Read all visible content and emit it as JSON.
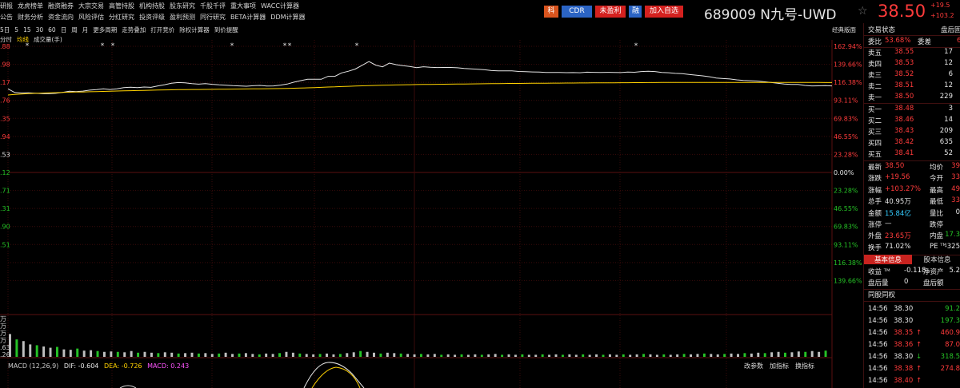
{
  "menu": {
    "row1": [
      "研报",
      "龙虎榜单",
      "融资融券",
      "大宗交易",
      "高管持股",
      "机构持股",
      "股东研究",
      "千股千评",
      "重大事项",
      "WACC计算器"
    ],
    "row2": [
      "公告",
      "财务分析",
      "资金流向",
      "风险评估",
      "分红研究",
      "投资评级",
      "盈利预测",
      "同行研究",
      "BETA计算器",
      "DDM计算器"
    ]
  },
  "toolbar": {
    "items": [
      "5日",
      "5",
      "15",
      "30",
      "60",
      "日",
      "周",
      "月",
      "更多周期",
      "走势叠加",
      "打开竞价",
      "除权计算器",
      "到价提醒"
    ],
    "right_label": "经典版面"
  },
  "subtabs": {
    "items": [
      "分时",
      "均线",
      "成交量(手)"
    ],
    "active": 1
  },
  "header": {
    "tags": [
      {
        "label": "科",
        "bg": "#d9541e",
        "color": "#ffffff"
      },
      {
        "label": "CDR",
        "bg": "#2b64c4",
        "color": "#ffffff"
      },
      {
        "label": "未盈利",
        "bg": "#d4211f",
        "color": "#ffffff"
      },
      {
        "label": "融",
        "bg": "#2b64c4",
        "color": "#ffffff"
      },
      {
        "label": "加入自选",
        "bg": "#d4211f",
        "color": "#ffffff"
      }
    ],
    "code_name": "689009 N九号-UWD",
    "star_icon": "star-icon",
    "price": "38.50",
    "change_a": "+19.5",
    "change_b": "+103.2"
  },
  "axes": {
    "right_pct_up": [
      "162.94%",
      "139.66%",
      "116.38%",
      "93.11%",
      "69.83%",
      "46.55%",
      "23.28%"
    ],
    "zero": "0.00%",
    "right_pct_down": [
      "23.28%",
      "46.55%",
      "69.83%",
      "93.11%",
      "116.38%",
      "139.66%"
    ],
    "left_prices": [
      ".88",
      ".98",
      ".17",
      ".76",
      ".35",
      ".94",
      ".53",
      ".12",
      ".71",
      ".31",
      ".90",
      ".51"
    ],
    "vol_labels": [
      "万",
      "万",
      "万",
      "万",
      ".63",
      ".26"
    ]
  },
  "macd": {
    "title": "MACD (12,26,9)",
    "dif": "DIF: -0.604",
    "dea": "DEA: -0.726",
    "macd": "MACD: 0.243",
    "buttons": [
      "改参数",
      "加指标",
      "换指标"
    ]
  },
  "panel": {
    "header_left": "交易状态",
    "header_right": "盘后固",
    "wb_label": "委比",
    "wb_value": "53.68%",
    "wc_label": "委差",
    "wc_value": "6",
    "sells": [
      {
        "label": "卖五",
        "price": "38.55",
        "vol": "17"
      },
      {
        "label": "卖四",
        "price": "38.53",
        "vol": "12"
      },
      {
        "label": "卖三",
        "price": "38.52",
        "vol": "6"
      },
      {
        "label": "卖二",
        "price": "38.51",
        "vol": "12"
      },
      {
        "label": "卖一",
        "price": "38.50",
        "vol": "229"
      }
    ],
    "buys": [
      {
        "label": "买一",
        "price": "38.48",
        "vol": "3"
      },
      {
        "label": "买二",
        "price": "38.46",
        "vol": "14"
      },
      {
        "label": "买三",
        "price": "38.43",
        "vol": "209"
      },
      {
        "label": "买四",
        "price": "38.42",
        "vol": "635"
      },
      {
        "label": "买五",
        "price": "38.41",
        "vol": "52"
      }
    ],
    "stats": [
      {
        "l1": "最新",
        "v1": "38.50",
        "c1": "red",
        "l2": "均价",
        "v2": "39",
        "c2": "red"
      },
      {
        "l1": "涨跌",
        "v1": "+19.56",
        "c1": "red",
        "l2": "今开",
        "v2": "33",
        "c2": "red"
      },
      {
        "l1": "涨幅",
        "v1": "+103.27%",
        "c1": "red",
        "l2": "最高",
        "v2": "49",
        "c2": "red"
      },
      {
        "l1": "总手",
        "v1": "40.95万",
        "c1": "white",
        "l2": "最低",
        "v2": "33",
        "c2": "red"
      },
      {
        "l1": "金额",
        "v1": "15.84亿",
        "c1": "cyan",
        "l2": "量比",
        "v2": "0",
        "c2": "white"
      },
      {
        "l1": "涨停",
        "v1": "—",
        "c1": "white",
        "l2": "跌停",
        "v2": "",
        "c2": "white"
      },
      {
        "l1": "外盘",
        "v1": "23.65万",
        "c1": "red",
        "l2": "内盘",
        "v2": "17.3",
        "c2": "green"
      },
      {
        "l1": "换手",
        "v1": "71.02%",
        "c1": "white",
        "l2": "PE ᵀᴹ",
        "v2": "-325",
        "c2": "white"
      }
    ],
    "tab_basic": "基本信息",
    "tab_quote": "股本信息",
    "info": [
      {
        "l1": "收益 ᵀᴹ",
        "v1": "-0.118",
        "l2": "净资产",
        "v2": "5.2"
      },
      {
        "l1": "盘后量",
        "v1": "0",
        "l2": "盘后额",
        "v2": ""
      }
    ],
    "tongan": "同股同权",
    "ticks": [
      {
        "time": "14:56",
        "price": "38.30",
        "vol": "91.2",
        "pc": "white",
        "vc": "green",
        "arrow": ""
      },
      {
        "time": "14:56",
        "price": "38.30",
        "vol": "197.3",
        "pc": "white",
        "vc": "green",
        "arrow": ""
      },
      {
        "time": "14:56",
        "price": "38.35",
        "vol": "460.9",
        "pc": "red",
        "vc": "red",
        "arrow": "↑"
      },
      {
        "time": "14:56",
        "price": "38.36",
        "vol": "87.0",
        "pc": "red",
        "vc": "red",
        "arrow": "↑"
      },
      {
        "time": "14:56",
        "price": "38.30",
        "vol": "318.5",
        "pc": "white",
        "vc": "green",
        "arrow": "↓"
      },
      {
        "time": "14:56",
        "price": "38.38",
        "vol": "274.8",
        "pc": "red",
        "vc": "red",
        "arrow": "↑"
      },
      {
        "time": "14:56",
        "price": "38.40",
        "vol": "",
        "pc": "red",
        "vc": "red",
        "arrow": "↑"
      }
    ]
  },
  "chart_data": {
    "type": "line",
    "series": [
      {
        "values": [
          108.0,
          103.2,
          102.6,
          102.8,
          102.4,
          101.9,
          101.7,
          102.2,
          103.4,
          104.9,
          104.4,
          105.1,
          106.3,
          107.0,
          108.1,
          107.2,
          108.0,
          109.5,
          110.0,
          109.6,
          110.3,
          109.9,
          111.8,
          113.3,
          115.3,
          116.1,
          115.7,
          114.7,
          114.1,
          114.8,
          113.9,
          113.1,
          112.7,
          112.1,
          111.8,
          111.4,
          112.0,
          112.4,
          111.7,
          111.8,
          112.8,
          114.2,
          116.6,
          118.6,
          120.4,
          120.4,
          120.4,
          124.2,
          124.2,
          128.6,
          130.8,
          133.5,
          138.4,
          143.2,
          138.6,
          136.4,
          141.3,
          139.2,
          137.9,
          136.8,
          135.4,
          136.5,
          135.8,
          135.5,
          135.6,
          135.6,
          135.2,
          134.3,
          133.9,
          133.2,
          132.6,
          131.6,
          131.2,
          131.3,
          131.2,
          130.5,
          130.1,
          129.8,
          129.6,
          129.2,
          129.2,
          129.2,
          128.9,
          129.0,
          128.8,
          129.5,
          129.3,
          129.1,
          129.3,
          129.2,
          129.0,
          129.6,
          129.4,
          130.4,
          130.8,
          130.4,
          129.2,
          128.8,
          128.0,
          127.6,
          126.6,
          125.7,
          124.8,
          123.6,
          121.9,
          121.3,
          120.8,
          119.6,
          118.9,
          118.5,
          118.1,
          117.2,
          116.3,
          115.2,
          114.2,
          113.8,
          113.6,
          112.4,
          111.8,
          111.9,
          112.1,
          111.8
        ]
      },
      {
        "values": [
          100.0,
          100.8,
          101.4,
          101.8,
          102.2,
          102.5,
          102.8,
          103.0,
          103.3,
          103.6,
          103.8,
          104.0,
          104.3,
          104.5,
          104.7,
          105.0,
          105.2,
          105.4,
          105.6,
          105.8,
          106.0,
          106.2,
          106.4,
          106.6,
          106.7,
          106.9,
          107.0,
          107.1,
          107.2,
          107.3,
          107.4,
          107.5,
          107.6,
          107.7,
          107.8,
          107.9,
          108.0,
          108.1,
          108.2,
          108.3,
          108.4,
          108.6,
          108.8,
          109.0,
          109.3,
          109.6,
          109.9,
          110.3,
          110.6,
          111.0,
          111.3,
          111.6,
          111.9,
          112.2,
          112.4,
          112.6,
          112.8,
          113.0,
          113.2,
          113.3,
          113.5,
          113.6,
          113.7,
          113.9,
          114.0,
          114.1,
          114.2,
          114.3,
          114.4,
          114.5,
          114.6,
          114.7,
          114.8,
          114.9,
          115.0,
          115.0,
          115.1,
          115.2,
          115.3,
          115.3,
          115.4,
          115.4,
          115.5,
          115.5,
          115.6,
          115.6,
          115.7,
          115.7,
          115.8,
          115.8,
          115.9,
          115.9,
          116.0,
          116.0,
          116.1,
          116.1,
          116.2,
          116.2,
          116.2,
          116.3,
          116.3,
          116.3,
          116.3,
          116.3,
          116.3,
          116.3,
          116.3,
          116.3,
          116.3,
          116.3,
          116.3,
          116.3,
          116.3,
          116.3,
          116.3,
          116.3,
          116.3,
          116.2,
          116.2,
          116.2,
          116.1,
          116.1
        ]
      }
    ],
    "volumes": [
      0.55,
      0.42,
      0.38,
      0.3,
      0.28,
      0.25,
      0.22,
      0.24,
      0.18,
      0.17,
      0.2,
      0.15,
      0.16,
      0.14,
      0.12,
      0.13,
      0.12,
      0.11,
      0.14,
      0.1,
      0.12,
      0.1,
      0.09,
      0.11,
      0.1,
      0.08,
      0.09,
      0.1,
      0.08,
      0.09,
      0.07,
      0.08,
      0.1,
      0.07,
      0.08,
      0.09,
      0.07,
      0.06,
      0.08,
      0.07,
      0.09,
      0.12,
      0.1,
      0.08,
      0.07,
      0.06,
      0.07,
      0.08,
      0.06,
      0.07,
      0.09,
      0.11,
      0.14,
      0.12,
      0.1,
      0.08,
      0.1,
      0.09,
      0.08,
      0.07,
      0.06,
      0.07,
      0.06,
      0.07,
      0.05,
      0.06,
      0.05,
      0.06,
      0.05,
      0.06,
      0.05,
      0.06,
      0.07,
      0.05,
      0.06,
      0.05,
      0.06,
      0.05,
      0.05,
      0.06,
      0.05,
      0.06,
      0.05,
      0.06,
      0.05,
      0.06,
      0.05,
      0.06,
      0.05,
      0.06,
      0.05,
      0.06,
      0.05,
      0.06,
      0.07,
      0.06,
      0.05,
      0.06,
      0.05,
      0.06,
      0.07,
      0.06,
      0.07,
      0.08,
      0.07,
      0.06,
      0.07,
      0.08,
      0.07,
      0.09,
      0.08,
      0.1,
      0.09,
      0.11,
      0.12,
      0.1,
      0.11,
      0.13,
      0.12,
      0.14,
      0.12,
      0.15
    ],
    "ylim": [
      -139.66,
      162.94
    ],
    "grid": true
  }
}
